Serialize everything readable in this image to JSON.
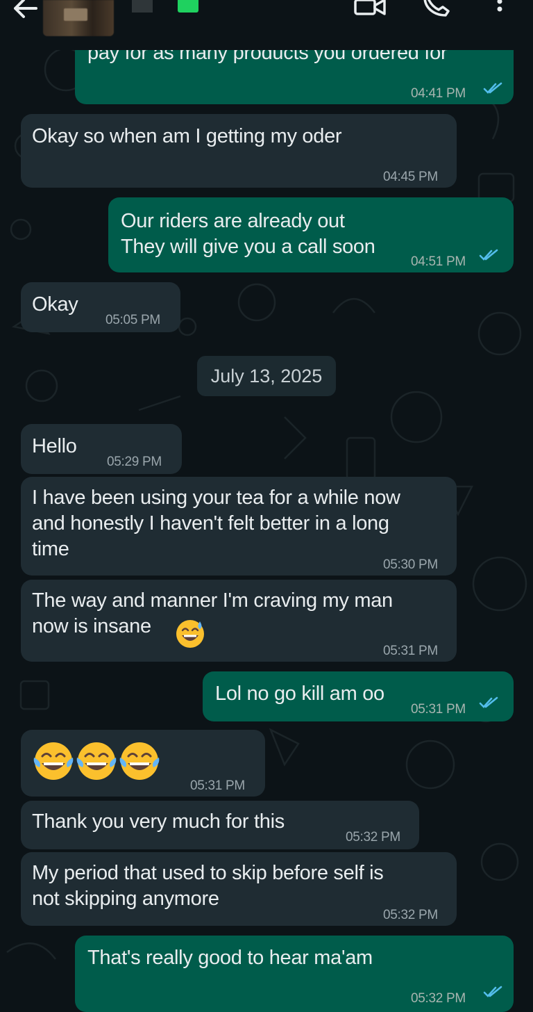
{
  "header": {
    "back_icon": "arrow-left-icon",
    "video_icon": "video-camera-icon",
    "call_icon": "phone-icon",
    "menu_icon": "more-vertical-icon"
  },
  "colors": {
    "background": "#0c1317",
    "incoming_bubble": "#1f2c33",
    "outgoing_bubble": "#005c4b",
    "read_ticks": "#53bdeb"
  },
  "messages": [
    {
      "dir": "out",
      "text": "pay for as many products you ordered for",
      "time": "04:41 PM",
      "read": true
    },
    {
      "dir": "in",
      "text": "Okay so when am I getting my oder",
      "time": "04:45 PM"
    },
    {
      "dir": "out",
      "text": "Our riders are already out\nThey will give you a call soon",
      "time": "04:51 PM",
      "read": true
    },
    {
      "dir": "in",
      "text": "Okay",
      "time": "05:05 PM"
    },
    {
      "dir": "in",
      "text": "Hello",
      "time": "05:29 PM"
    },
    {
      "dir": "in",
      "text": "I have been using your tea for a while now\nand honestly I haven't felt better in a long\ntime",
      "time": "05:30 PM"
    },
    {
      "dir": "in",
      "text": "The way and manner I'm craving my man\nnow is insane",
      "time": "05:31 PM"
    },
    {
      "dir": "out",
      "text": "Lol no go kill am oo",
      "time": "05:31 PM",
      "read": true
    },
    {
      "dir": "in",
      "text": "",
      "emoji": "face-with-tears-of-joy-emoji ×3",
      "time": "05:31 PM"
    },
    {
      "dir": "in",
      "text": "Thank you very much for this",
      "time": "05:32 PM"
    },
    {
      "dir": "in",
      "text": "My period that used to skip before self is\nnot skipping anymore",
      "time": "05:32 PM"
    },
    {
      "dir": "out",
      "text": "That's really good to hear ma'am",
      "time": "05:32 PM",
      "read": true
    }
  ],
  "date_separator": "July 13, 2025"
}
